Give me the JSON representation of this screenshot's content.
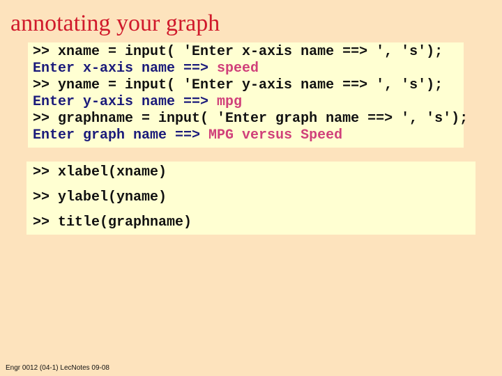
{
  "title": "annotating your graph",
  "block1": {
    "lines": [
      {
        "type": "prompt",
        "text": ">> xname = input( 'Enter x-axis name ==> ', 's');"
      },
      {
        "type": "output",
        "text": "Enter x-axis name ==> ",
        "response": "speed"
      },
      {
        "type": "prompt",
        "text": ">> yname = input( 'Enter y-axis name ==> ', 's');"
      },
      {
        "type": "output",
        "text": "Enter y-axis name ==> ",
        "response": "mpg"
      },
      {
        "type": "prompt",
        "text": ">> graphname = input( 'Enter graph name ==> ', 's');"
      },
      {
        "type": "output",
        "text": "Enter graph name ==> ",
        "response": "MPG versus Speed"
      }
    ]
  },
  "block2": {
    "lines": [
      ">> xlabel(xname)",
      ">> ylabel(yname)",
      ">> title(graphname)"
    ]
  },
  "footer": "Engr 0012 (04-1) LecNotes 09-08",
  "colors": {
    "background": "#fde3bd",
    "title": "#d0192b",
    "code_box": "#ffffd2",
    "output": "#1a1a7a",
    "response": "#d0407a"
  }
}
